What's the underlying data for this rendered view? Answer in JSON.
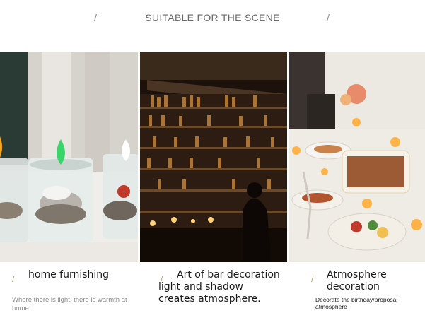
{
  "header": {
    "title": "SUITABLE FOR THE SCENE",
    "slash_left": "/",
    "slash_right": "/"
  },
  "panels": [
    {
      "image_icon": "candles-on-table-photo",
      "slash": "/",
      "title": "home furnishing",
      "subtitle": "Where there is light, there is warmth at home."
    },
    {
      "image_icon": "bar-shelves-photo",
      "slash": "/",
      "title": "Art of bar decoration light and shadow creates atmosphere.",
      "subtitle": ""
    },
    {
      "image_icon": "dinner-table-photo",
      "slash": "/",
      "title": "Atmosphere decoration",
      "subtitle": "Decorate the birthday/proposal atmosphere"
    }
  ],
  "colors": {
    "flame_green": "#39d46a",
    "flame_orange": "#f5a623",
    "bar_wood": "#2a1a10",
    "accent": "#b89a6a"
  }
}
